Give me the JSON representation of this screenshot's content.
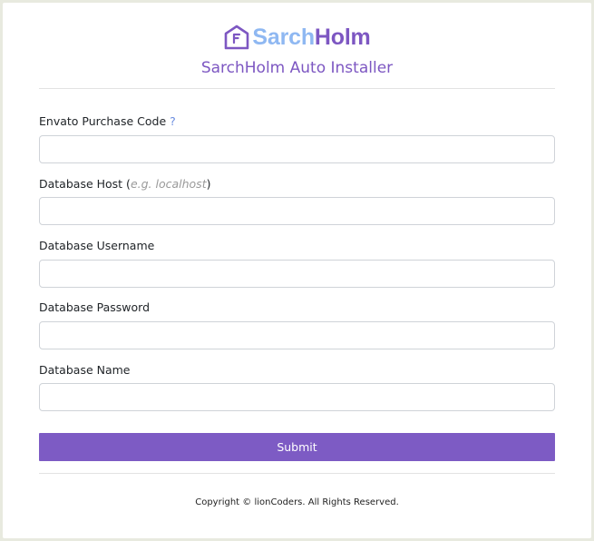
{
  "brand": {
    "name_part1": "Sarch",
    "name_part2": "Holm",
    "logo_icon": "house-icon",
    "color_light": "#8fb8f2",
    "color_primary": "#7d57c2"
  },
  "header": {
    "title": "SarchHolm Auto Installer"
  },
  "form": {
    "purchase_code": {
      "label": "Envato Purchase Code",
      "help": "?",
      "value": ""
    },
    "db_host": {
      "label": "Database Host",
      "hint_open": " (",
      "hint": "e.g. localhost",
      "hint_close": ")",
      "value": ""
    },
    "db_username": {
      "label": "Database Username",
      "value": ""
    },
    "db_password": {
      "label": "Database Password",
      "value": ""
    },
    "db_name": {
      "label": "Database Name",
      "value": ""
    },
    "submit_label": "Submit"
  },
  "footer": {
    "copyright": "Copyright © lionCoders. All Rights Reserved."
  }
}
